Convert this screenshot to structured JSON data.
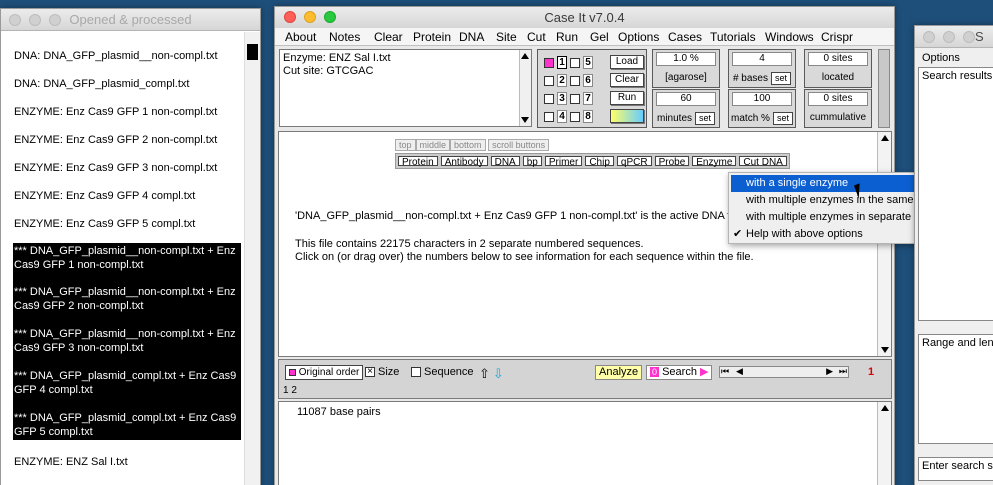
{
  "left_window": {
    "title": "Opened & processed",
    "items": [
      {
        "text": "DNA: DNA_GFP_plasmid__non-compl.txt",
        "selected": false
      },
      {
        "text": "DNA: DNA_GFP_plasmid_compl.txt",
        "selected": false
      },
      {
        "text": "ENZYME: Enz Cas9 GFP 1 non-compl.txt",
        "selected": false
      },
      {
        "text": "ENZYME: Enz Cas9 GFP 2 non-compl.txt",
        "selected": false
      },
      {
        "text": "ENZYME: Enz Cas9 GFP 3 non-compl.txt",
        "selected": false
      },
      {
        "text": "ENZYME: Enz Cas9 GFP 4 compl.txt",
        "selected": false
      },
      {
        "text": "ENZYME: Enz Cas9 GFP 5 compl.txt",
        "selected": false
      },
      {
        "text": "*** DNA_GFP_plasmid__non-compl.txt + Enz Cas9 GFP 1 non-compl.txt",
        "selected": true
      },
      {
        "text": "*** DNA_GFP_plasmid__non-compl.txt + Enz Cas9 GFP 2 non-compl.txt",
        "selected": true
      },
      {
        "text": "*** DNA_GFP_plasmid__non-compl.txt + Enz Cas9 GFP 3 non-compl.txt",
        "selected": true
      },
      {
        "text": "*** DNA_GFP_plasmid_compl.txt + Enz Cas9 GFP 4 compl.txt",
        "selected": true
      },
      {
        "text": "*** DNA_GFP_plasmid_compl.txt + Enz Cas9 GFP 5 compl.txt",
        "selected": true
      },
      {
        "text": "ENZYME: ENZ Sal I.txt",
        "selected": false
      }
    ]
  },
  "main_window": {
    "title": "Case It v7.0.4",
    "menu": [
      "About",
      "Notes",
      "Clear",
      "Protein",
      "DNA",
      "Site",
      "Cut",
      "Run",
      "Gel",
      "Options",
      "Cases",
      "Tutorials",
      "Windows",
      "Crispr"
    ],
    "info": {
      "line1": "Enzyme: ENZ Sal I.txt",
      "line2": "Cut site: GTCGAC"
    },
    "lanes": [
      "1",
      "2",
      "3",
      "4",
      "5",
      "6",
      "7",
      "8"
    ],
    "buttons": {
      "load": "Load",
      "clear": "Clear",
      "run": "Run"
    },
    "params": {
      "agarose_val": "1.0 %",
      "agarose_label": "[agarose]",
      "bases_val": "4",
      "bases_label": "# bases",
      "set": "set",
      "sites1_val": "0 sites",
      "sites1_label": "located",
      "minutes_val": "60",
      "minutes_label": "minutes",
      "match_val": "100",
      "match_label": "match %",
      "sites2_val": "0 sites",
      "sites2_label": "cummulative"
    },
    "scroll_tabs": [
      "top",
      "middle",
      "bottom",
      "scroll buttons"
    ],
    "tools": [
      "Protein",
      "Antibody",
      "DNA",
      "bp",
      "Primer",
      "Chip",
      "qPCR",
      "Probe",
      "Enzyme",
      "Cut DNA"
    ],
    "messages": {
      "m1": "'DNA_GFP_plasmid__non-compl.txt + Enz Cas9 GFP 1 non-compl.txt' is the active DNA file.",
      "m2": "This file contains 22175 characters in 2 separate numbered sequences.",
      "m3": "Click on (or drag over) the numbers below to see information for each sequence within the file."
    },
    "seqbar": {
      "original_order": "Original order",
      "size": "Size",
      "sequence": "Sequence",
      "analyze": "Analyze",
      "search": "Search",
      "search_badge": "0",
      "nums": "1  2",
      "red_num": "1"
    },
    "bp_text": "11087 base pairs"
  },
  "context_menu": {
    "items": [
      {
        "label": "with a single enzyme",
        "highlighted": true
      },
      {
        "label": "with multiple enzymes in the same digestion",
        "highlighted": false
      },
      {
        "label": "with multiple enzymes in separate digestions",
        "highlighted": false
      },
      {
        "label": "Help with above options",
        "highlighted": false,
        "checked": true,
        "submenu": true
      }
    ]
  },
  "right_window": {
    "title": "S",
    "options": "Options",
    "search_results": "Search results f",
    "range": "Range and leng",
    "enter_search": "Enter search se"
  }
}
